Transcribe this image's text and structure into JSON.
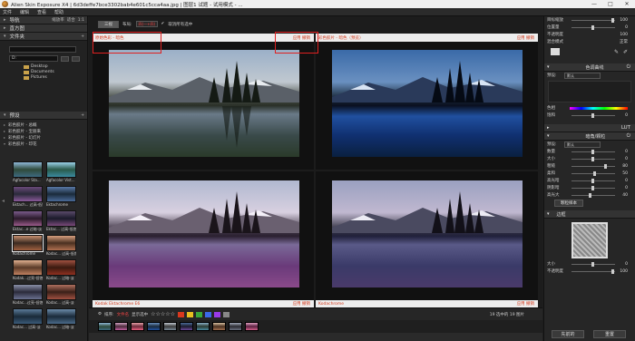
{
  "window": {
    "title": "Alien Skin Exposure X4 | 6d3deffe7bce3302bab4e601c5cca4aa.jpg | 图层1 试题 - 试用模式 - ...",
    "controls": [
      "—",
      "□",
      "✕"
    ]
  },
  "menu": [
    "文件",
    "编辑",
    "查看",
    "帮助"
  ],
  "left_panel": {
    "navigator": {
      "label": "导航",
      "right_labels": [
        "缩放率",
        "适合",
        "1:1"
      ]
    },
    "histogram": {
      "label": "直方图"
    },
    "folders": {
      "label": "文件夹",
      "path_value": "D:",
      "tree": [
        "Desktop",
        "Documents",
        "Pictures"
      ]
    },
    "presets": {
      "label": "预设",
      "items": [
        "彩色胶片 - 总概",
        "彩色胶片 - 宝丽来",
        "彩色胶片 - 幻灯片",
        "彩色胶片 - 印花"
      ]
    },
    "thumbnails": [
      {
        "caption": "Agfacolor Sta..."
      },
      {
        "caption": "Agfacolor Vist..."
      },
      {
        "caption": "Ektach... 过高-低饱"
      },
      {
        "caption": "Ektachrome"
      },
      {
        "caption": "Ektac...e 过暗-淡"
      },
      {
        "caption": "Ektac... 过高-低饱"
      },
      {
        "caption": "Kodachrome"
      },
      {
        "caption": "Kodac... 过高-低饱"
      },
      {
        "caption": "Kodak...过亮-低饱"
      },
      {
        "caption": "Kodac... 过暗-淡"
      },
      {
        "caption": "Kodac...过亮-低饱"
      },
      {
        "caption": "Kodac... 过高-淡"
      },
      {
        "caption": "Kodac... 过高-淡"
      },
      {
        "caption": "Kodac... 过暗-淡"
      }
    ]
  },
  "toolbar": {
    "compare_btn": "三视",
    "layout_label": "布局:",
    "layout_value": "四(一+四)",
    "sync_label": "联动缩放",
    "show_selected": "显示选中",
    "checkbox_label": "取消所有选中"
  },
  "panes": [
    {
      "name": "原始色彩 - 暗色",
      "apply": "应用 撤销"
    },
    {
      "name": "彩色胶片 - 暗色（预览）",
      "apply": "应用 撤销"
    },
    {
      "name": "Kodak Ektachrome E6",
      "apply": "应用 撤销"
    },
    {
      "name": "Kodachrome",
      "apply": "应用 撤销"
    }
  ],
  "bottom": {
    "sort_label": "排序:",
    "sort_value": "文件名",
    "filter_label": "显示选中",
    "count": "19 选中的 19 图片",
    "rating_stars": "☆☆☆☆☆",
    "label_colors": [
      "#d9381e",
      "#e8c020",
      "#3aa83a",
      "#3a6ae8",
      "#9a3ae8",
      "#888888"
    ]
  },
  "right_panel": {
    "top_rows": [
      {
        "label": "目标缩放",
        "value": "100"
      },
      {
        "label": "位置量",
        "value": "0"
      },
      {
        "label": "不透明度",
        "value": "100"
      },
      {
        "label": "混合模式",
        "value": "正常"
      }
    ],
    "color_section": {
      "label": "色调曲线",
      "preset": "默认"
    },
    "color_rows": [
      {
        "label": "色相",
        "value": "0"
      },
      {
        "label": "饱和",
        "value": "0"
      }
    ],
    "lut_label": "LUT",
    "grain_section": {
      "label": "暗角/颗粒",
      "preset": "默认"
    },
    "grain_rows": [
      {
        "label": "数量",
        "value": "0"
      },
      {
        "label": "大小",
        "value": "0"
      },
      {
        "label": "粗糙",
        "value": "80"
      },
      {
        "label": "柔和",
        "value": "50"
      },
      {
        "label": "高光暗",
        "value": "0"
      },
      {
        "label": "阴影暗",
        "value": "0"
      },
      {
        "label": "高光大",
        "value": "40"
      }
    ],
    "grain_btn": "颗粒样本",
    "frame_section": {
      "label": "边框"
    },
    "frame_rows": [
      {
        "label": "大小",
        "value": "0"
      },
      {
        "label": "不透明度",
        "value": "100"
      }
    ],
    "buttons": {
      "prev": "先前的",
      "reset": "重置"
    }
  }
}
